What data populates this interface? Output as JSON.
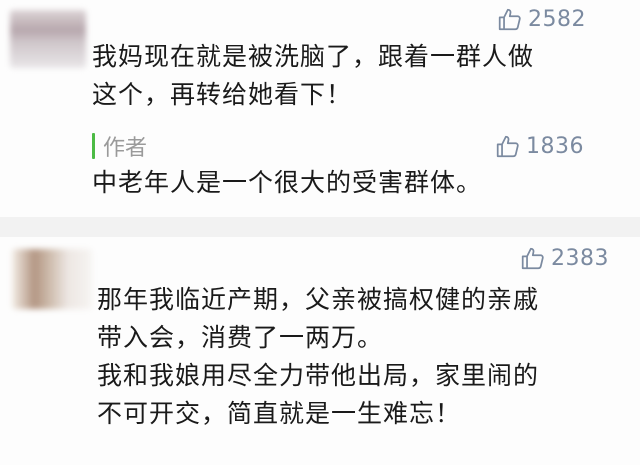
{
  "comments": [
    {
      "likes": "2582",
      "lines": [
        "我妈现在就是被洗脑了，跟着一群人做",
        "这个，再转给她看下！"
      ],
      "reply": {
        "author": "作者",
        "likes": "1836",
        "text": "中老年人是一个很大的受害群体。"
      }
    },
    {
      "likes": "2383",
      "lines": [
        "那年我临近产期，父亲被搞权健的亲戚",
        "带入会，消费了一两万。",
        "我和我娘用尽全力带他出局，家里闹的",
        "不可开交，简直就是一生难忘！"
      ]
    }
  ],
  "colors": {
    "like_gray": "#7b8aa0",
    "author_bar_green": "#4cbb45",
    "author_gray": "#9a9a9a"
  },
  "icons": [
    "thumbs-up-icon"
  ]
}
